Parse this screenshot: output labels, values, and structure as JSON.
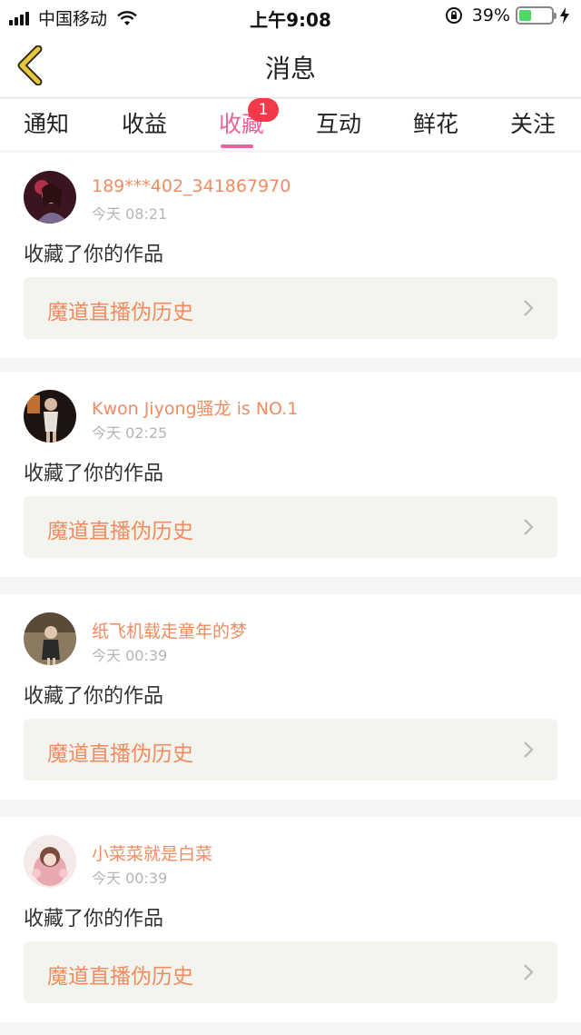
{
  "status_bar": {
    "carrier": "中国移动",
    "time": "上午9:08",
    "battery_percent": "39%",
    "battery_level": 0.39
  },
  "nav": {
    "title": "消息"
  },
  "tabs": [
    {
      "label": "通知"
    },
    {
      "label": "收益"
    },
    {
      "label": "收藏",
      "badge": "1",
      "active": true
    },
    {
      "label": "互动"
    },
    {
      "label": "鲜花"
    },
    {
      "label": "关注"
    }
  ],
  "messages": [
    {
      "username": "189***402_341867970",
      "time": "今天 08:21",
      "action": "收藏了你的作品",
      "work": "魔道直播伪历史"
    },
    {
      "username": "Kwon Jiyong骚龙 is NO.1",
      "time": "今天 02:25",
      "action": "收藏了你的作品",
      "work": "魔道直播伪历史"
    },
    {
      "username": "纸飞机载走童年的梦",
      "time": "今天 00:39",
      "action": "收藏了你的作品",
      "work": "魔道直播伪历史"
    },
    {
      "username": "小菜菜就是白菜",
      "time": "今天 00:39",
      "action": "收藏了你的作品",
      "work": "魔道直播伪历史"
    }
  ],
  "colors": {
    "accent": "#f0609a",
    "username": "#f08c60",
    "badge": "#f23a4a",
    "back_arrow": "#e8c73a"
  }
}
